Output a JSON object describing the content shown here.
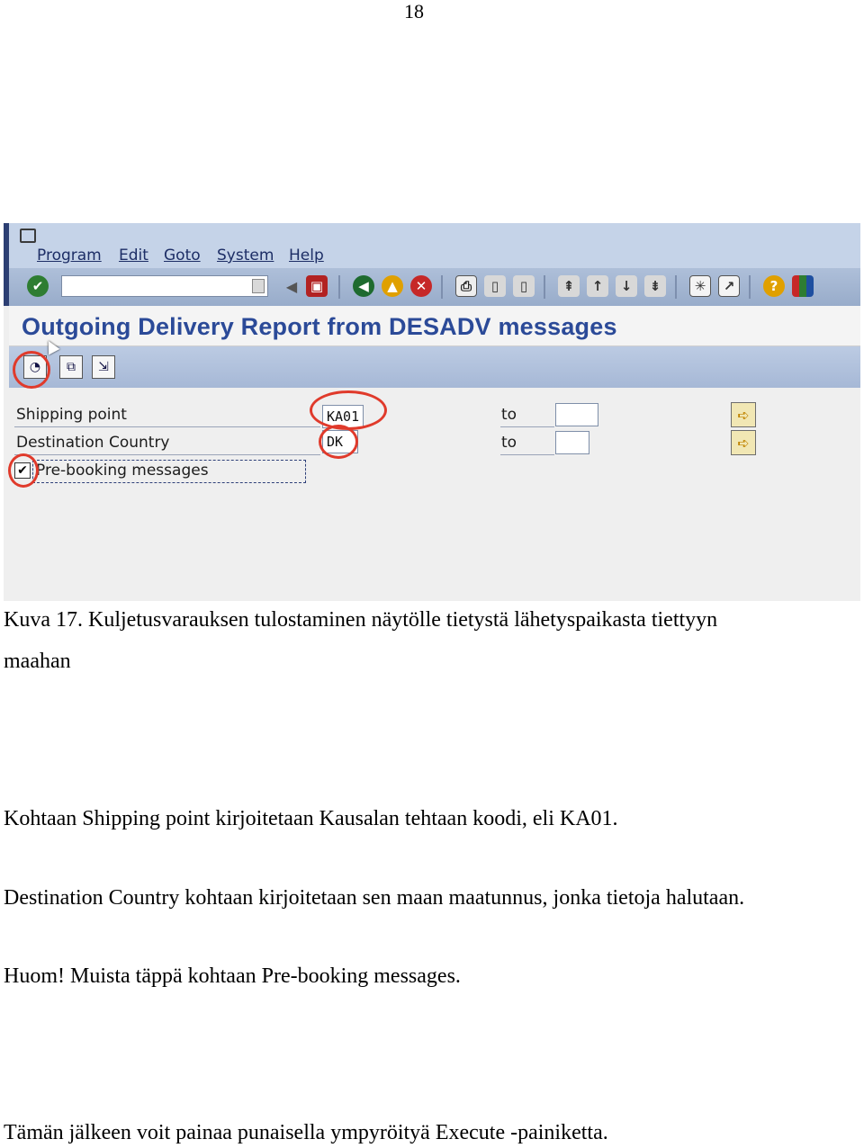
{
  "page_number": "18",
  "sap": {
    "menu": [
      "Program",
      "Edit",
      "Goto",
      "System",
      "Help"
    ],
    "title": "Outgoing Delivery Report from DESADV messages",
    "fields": {
      "shipping_point": {
        "label": "Shipping point",
        "value": "KA01",
        "to_label": "to",
        "to_value": ""
      },
      "destination_country": {
        "label": "Destination Country",
        "value": "DK",
        "to_label": "to",
        "to_value": ""
      },
      "prebooking": {
        "label": "Pre-booking messages",
        "checked": true,
        "mark": "✔"
      }
    },
    "icons": {
      "enter": "checkmark-icon",
      "back": "back-icon",
      "exit": "exit-icon",
      "cancel": "cancel-icon",
      "save": "save-icon",
      "print": "print-icon",
      "find": "find-icon",
      "help": "help-icon",
      "execute": "execute-icon",
      "variant": "get-variant-icon",
      "selection": "selection-options-icon",
      "multiple": "multiple-selection-arrow-icon"
    },
    "colors": {
      "title": "#2b4a98",
      "menubar": "#c5d3e8",
      "highlight": "#e03a2b",
      "toolbar_green": "#2e7d32"
    }
  },
  "caption": "Kuva 17. Kuljetusvarauksen tulostaminen näytölle tietystä lähetyspaikasta tiettyyn",
  "caption_cont": "maahan",
  "paragraphs": [
    "Kohtaan Shipping point kirjoitetaan Kausalan tehtaan koodi, eli KA01.",
    "Destination Country kohtaan kirjoitetaan sen maan maatunnus, jonka tietoja halutaan.",
    "Huom! Muista täppä kohtaan Pre-booking messages.",
    "Tämän jälkeen voit painaa punaisella ympyröityä Execute -painiketta."
  ]
}
